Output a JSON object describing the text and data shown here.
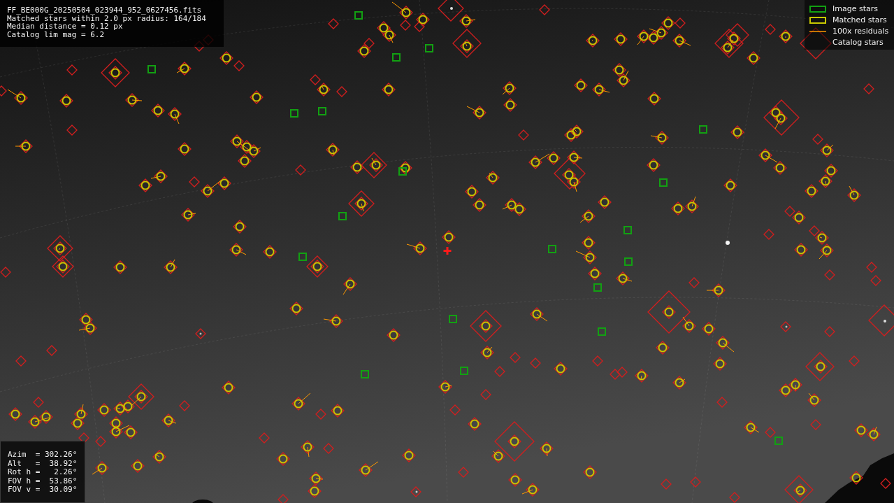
{
  "info_panel": {
    "lines": [
      "FF_BE000G_20250504_023944_952_0627456.fits",
      "Matched stars within 2.0 px radius: 164/184",
      "Median distance = 0.12 px",
      "Catalog lim mag = 6.2"
    ]
  },
  "legend": {
    "items": [
      {
        "label": "Image stars"
      },
      {
        "kind": "matched",
        "label": "Matched stars"
      },
      {
        "kind": "residual",
        "label": "100x residuals"
      },
      {
        "kind": "catalog",
        "label": "Catalog stars"
      }
    ]
  },
  "orientation_panel": {
    "lines": [
      "Azim  = 302.26°",
      "Alt   =  38.92°",
      "Rot h =   2.26°",
      "FOV h =  53.86°",
      "FOV v =  30.09°"
    ]
  }
}
